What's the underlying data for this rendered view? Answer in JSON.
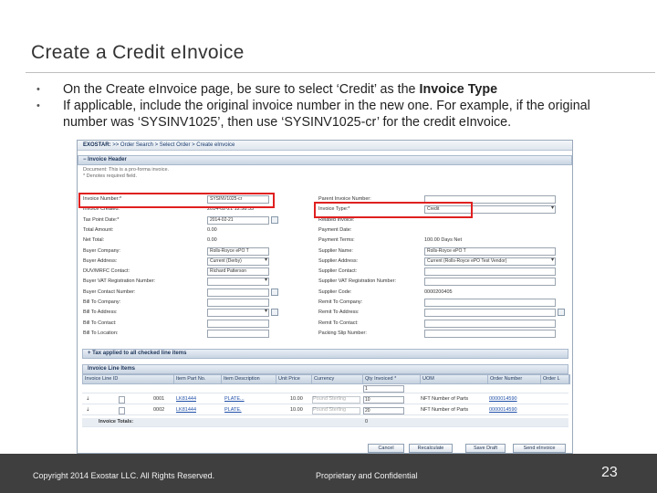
{
  "slide": {
    "title": "Create a Credit eInvoice",
    "bullets": [
      {
        "dot": "•",
        "text": "On the Create eInvoice page, be sure to select ‘Credit’ as the ",
        "bold": "Invoice Type"
      },
      {
        "dot": "•",
        "text": "If applicable, include the original invoice number in the new one.  For example, if the original number was ‘SYSINV1025’, then use ‘SYSINV1025-cr’ for the credit eInvoice.",
        "bold": ""
      }
    ],
    "footer": {
      "copyright": "Copyright 2014 Exostar LLC. All Rights Reserved.",
      "proprietary": "Proprietary and Confidential",
      "page_number": "23"
    }
  },
  "screenshot": {
    "breadcrumb_app": "EXOSTAR:",
    "breadcrumb_rest": " >> Order Search > Select Order > Create eInvoice",
    "invoice_header_label": "Invoice Header",
    "message_line1": "Document: This is a pro-forma invoice.",
    "message_line2": "* Denotes required field.",
    "left_fields": [
      {
        "label": "Invoice Number:*",
        "value": "SYSINV1025-cr",
        "kind": "input"
      },
      {
        "label": "Invoice Created:",
        "value": "2014-02-21 12:58:33",
        "kind": "text"
      },
      {
        "label": "Tax Point Date:*",
        "value": "2014-02-21",
        "kind": "input"
      },
      {
        "label": "Total Amount:",
        "value": "0.00",
        "kind": "text"
      },
      {
        "label": "Net Total:",
        "value": "0.00",
        "kind": "text"
      },
      {
        "label": "Buyer Company:",
        "value": "Rolls-Royce ePO T",
        "kind": "input"
      },
      {
        "label": "Buyer Address:",
        "value": "Current (Derby)",
        "kind": "dropdown"
      },
      {
        "label": "DUV/MRFC Contact:",
        "value": "Richard Patterson",
        "kind": "input"
      },
      {
        "label": "Buyer VAT Registration Number:",
        "value": "",
        "kind": "dropdown"
      },
      {
        "label": "Buyer Contact Number:",
        "value": "",
        "kind": "input"
      },
      {
        "label": "Bill To Company:",
        "value": "",
        "kind": "input"
      },
      {
        "label": "Bill To Address:",
        "value": "",
        "kind": "dropdown"
      },
      {
        "label": "Bill To Contact:",
        "value": "",
        "kind": "input"
      },
      {
        "label": "Bill To Location:",
        "value": "",
        "kind": "input"
      }
    ],
    "right_fields": [
      {
        "label": "Parent Invoice Number:",
        "value": "",
        "kind": "input"
      },
      {
        "label": "Invoice Type:*",
        "value": "Credit",
        "kind": "dropdown"
      },
      {
        "label": "Related Invoice:",
        "value": "",
        "kind": "text"
      },
      {
        "label": "Payment Date:",
        "value": "",
        "kind": "text"
      },
      {
        "label": "Payment Terms:",
        "value": "100.00 Days Net",
        "kind": "text"
      },
      {
        "label": "Supplier Name:",
        "value": "Rolls-Royce ePO T",
        "kind": "input"
      },
      {
        "label": "Supplier Address:",
        "value": "Current (Rolls-Royce ePO Test Vendor)",
        "kind": "dropdown"
      },
      {
        "label": "Supplier Contact:",
        "value": "",
        "kind": "input"
      },
      {
        "label": "Supplier VAT Registration Number:",
        "value": "",
        "kind": "input"
      },
      {
        "label": "Supplier Code:",
        "value": "0000200405",
        "kind": "text"
      },
      {
        "label": "Remit To Company:",
        "value": "",
        "kind": "input"
      },
      {
        "label": "Remit To Address:",
        "value": "",
        "kind": "input"
      },
      {
        "label": "Remit To Contact:",
        "value": "",
        "kind": "input"
      },
      {
        "label": "Packing Slip Number:",
        "value": "",
        "kind": "input"
      }
    ],
    "tax_applied_label": "+ Tax applied to all checked line items",
    "line_items_label": "Invoice Line Items",
    "columns": [
      "Invoice Line ID",
      "Item Part No.",
      "Item Description",
      "Unit Price",
      "Currency",
      "Qty Invoiced *",
      "UOM",
      "Order Number",
      "Order L"
    ],
    "qty_filter": "1",
    "rows": [
      {
        "line": "0001",
        "part": "LK81444",
        "desc": "PLATE...",
        "price": "10.00",
        "currency": "Pound Sterling",
        "qty": "10",
        "uom": "NFT Number of Parts",
        "order": "0000014590"
      },
      {
        "line": "0002",
        "part": "LK81444",
        "desc": "PLATE.",
        "price": "10.00",
        "currency": "Pound Sterling",
        "qty": "20",
        "uom": "NFT Number of Parts",
        "order": "0000014590"
      }
    ],
    "totals_label": "Invoice Totals:",
    "totals_qty": "0",
    "buttons": {
      "cancel": "Cancel",
      "recalculate": "Recalculate",
      "save": "Save Draft",
      "send": "Send eInvoice"
    }
  }
}
